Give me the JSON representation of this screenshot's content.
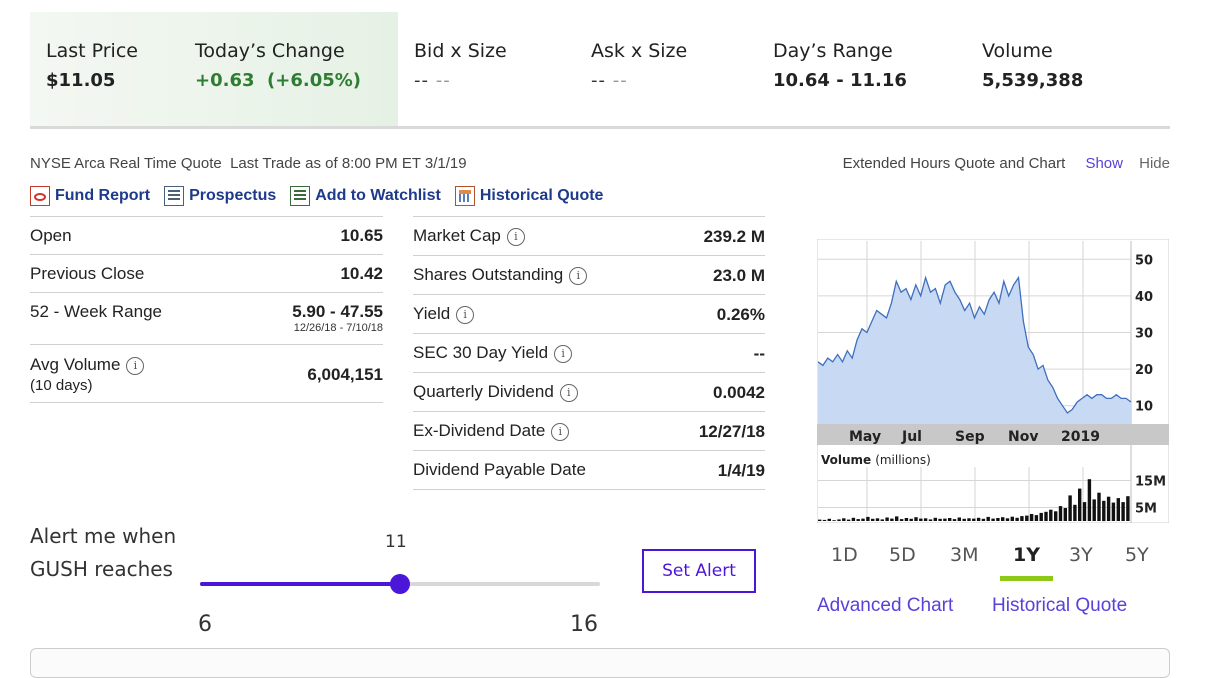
{
  "quote": {
    "last_price": {
      "label": "Last Price",
      "value": "$11.05"
    },
    "todays_change": {
      "label": "Today’s Change",
      "value": "+0.63  (+6.05%)"
    },
    "bid": {
      "label": "Bid x Size",
      "value_a": "--",
      "value_b": "--"
    },
    "ask": {
      "label": "Ask x Size",
      "value_a": "--",
      "value_b": "--"
    },
    "days_range": {
      "label": "Day’s Range",
      "value": "10.64 - 11.16"
    },
    "volume": {
      "label": "Volume",
      "value": "5,539,388"
    }
  },
  "meta": {
    "left": "NYSE Arca Real Time Quote  Last Trade as of 8:00 PM ET 3/1/19",
    "extended_label": "Extended Hours Quote and Chart",
    "show": "Show",
    "hide": "Hide"
  },
  "links": {
    "fund_report": "Fund Report",
    "prospectus": "Prospectus",
    "watchlist": "Add to Watchlist",
    "historical": "Historical Quote"
  },
  "left_stats": [
    {
      "key": "Open",
      "value": "10.65"
    },
    {
      "key": "Previous Close",
      "value": "10.42"
    },
    {
      "key": "52 - Week Range",
      "value": "5.90 - 47.55",
      "sub": "12/26/18 - 7/10/18"
    },
    {
      "key": "Avg Volume",
      "key2": "(10 days)",
      "value": "6,004,151"
    }
  ],
  "right_stats": [
    {
      "key": "Market Cap",
      "value": "239.2 M"
    },
    {
      "key": "Shares Outstanding",
      "value": "23.0 M"
    },
    {
      "key": "Yield",
      "value": "0.26%"
    },
    {
      "key": "SEC 30 Day Yield",
      "value": "--"
    },
    {
      "key": "Quarterly Dividend",
      "value": "0.0042"
    },
    {
      "key": "Ex-Dividend Date",
      "value": "12/27/18"
    },
    {
      "key": "Dividend Payable Date",
      "value": "1/4/19"
    }
  ],
  "chart_data": {
    "type": "area",
    "price": {
      "y_ticks": [
        "50",
        "40",
        "30",
        "20",
        "10"
      ],
      "ylim": [
        5,
        55
      ],
      "x_labels": [
        "May",
        "Jul",
        "Sep",
        "Nov",
        "2019"
      ],
      "values": [
        22,
        21,
        23,
        22,
        24,
        22,
        25,
        23,
        28,
        31,
        30,
        33,
        36,
        35,
        34,
        38,
        44,
        41,
        42,
        39,
        43,
        40,
        45,
        41,
        42,
        38,
        43,
        44,
        41,
        39,
        36,
        38,
        34,
        37,
        35,
        39,
        41,
        38,
        44,
        40,
        43,
        45,
        33,
        26,
        24,
        20,
        21,
        17,
        15,
        12,
        10,
        8,
        9,
        11,
        12,
        13,
        12,
        13,
        13,
        12,
        12,
        13,
        12,
        12,
        11
      ]
    },
    "volume": {
      "label_bold": "Volume",
      "label_unit": "(millions)",
      "y_ticks": [
        "15M",
        "5M"
      ],
      "ylim": [
        0,
        20
      ],
      "values": [
        0.5,
        0.4,
        0.8,
        0.3,
        0.6,
        1.0,
        0.5,
        1.2,
        0.7,
        0.9,
        1.5,
        0.8,
        1.0,
        0.6,
        1.3,
        0.9,
        1.7,
        0.7,
        1.1,
        0.8,
        1.4,
        0.9,
        1.0,
        0.6,
        1.2,
        0.8,
        0.9,
        1.1,
        0.7,
        1.3,
        0.8,
        1.0,
        0.9,
        1.2,
        0.8,
        1.5,
        0.9,
        1.1,
        1.4,
        1.0,
        1.6,
        1.2,
        1.8,
        2.0,
        2.6,
        2.2,
        3.0,
        3.4,
        4.2,
        3.6,
        5.5,
        4.8,
        9.5,
        6.0,
        12.0,
        7.0,
        15.5,
        8.0,
        10.5,
        7.5,
        9.0,
        6.8,
        8.5,
        7.0,
        9.2
      ]
    }
  },
  "range_tabs": [
    "1D",
    "5D",
    "3M",
    "1Y",
    "3Y",
    "5Y"
  ],
  "active_range": "1Y",
  "chart_links": {
    "advanced": "Advanced Chart",
    "historical": "Historical Quote"
  },
  "alert": {
    "text": "Alert me when GUSH reaches",
    "current": "11",
    "min": "6",
    "max": "16",
    "min_value": 6,
    "max_value": 16,
    "current_value": 11,
    "button": "Set Alert",
    "accent": "#4b16d8"
  },
  "colors": {
    "up": "#2e7d32",
    "link": "#1e3a8a",
    "accent": "#5b3fd9",
    "tab_underline": "#8ec91a"
  }
}
